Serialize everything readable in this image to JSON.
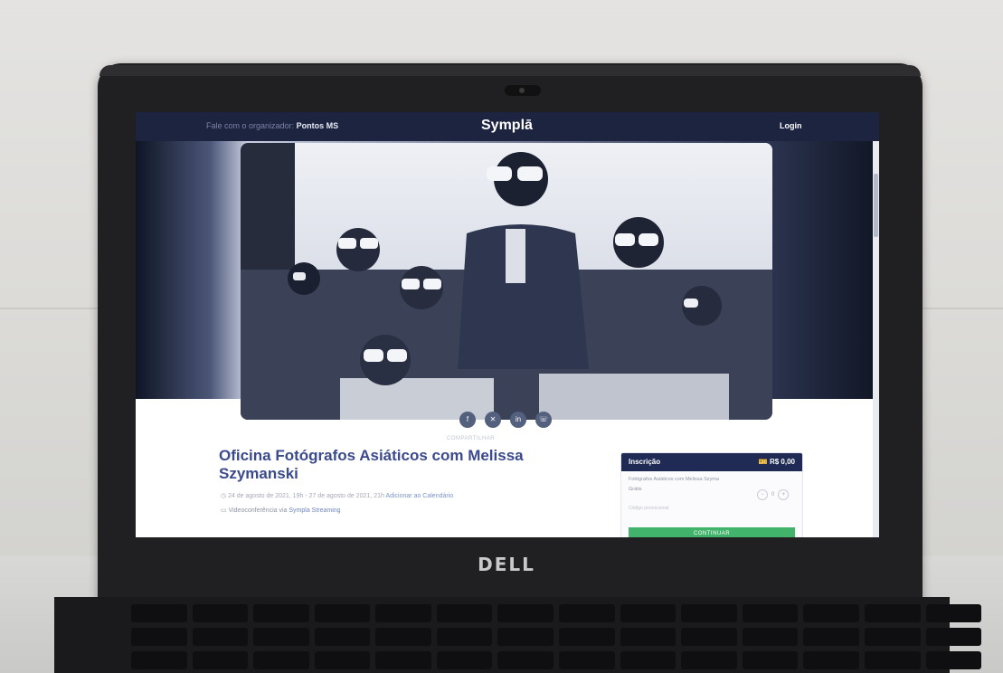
{
  "browser_page": {
    "header": {
      "organizer_prefix": "Fale com o organizador:",
      "organizer_name": "Pontos MS",
      "logo": "Symplā",
      "login": "Login"
    },
    "share_icons": [
      "facebook-icon",
      "twitter-icon",
      "linkedin-icon",
      "whatsapp-icon"
    ],
    "event": {
      "small_link": "COMPARTILHAR",
      "title": "Oficina Fotógrafos Asiáticos com Melissa Szymanski",
      "date": "24 de agosto de 2021, 19h - 27 de agosto de 2021, 21h",
      "add_calendar": "Adicionar ao Calendário",
      "place_prefix": "Videoconferência via",
      "place_link": "Sympla Streaming"
    },
    "ticket_panel": {
      "header_label": "Inscrição",
      "header_price": "R$ 0,00",
      "ticket_name": "Fotógrafos Asiáticos com Melissa Szyma",
      "ticket_price": "Grátis",
      "quantity": "0",
      "code_placeholder": "Código promocional",
      "button_label": "CONTINUAR"
    }
  },
  "laptop": {
    "brand": "DELL"
  },
  "colors": {
    "header_bg": "#1d2440",
    "title": "#3a4a8c",
    "ticket_header_bg": "#1f2a55",
    "button_green": "#42b36a"
  }
}
